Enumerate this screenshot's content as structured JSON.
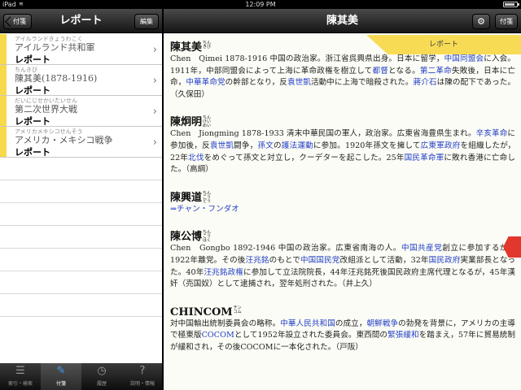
{
  "statusbar": {
    "carrier": "iPad",
    "wifi": "wifi-icon",
    "time": "12:09 PM",
    "battery_level": 0.85
  },
  "left_nav": {
    "back_label": "付箋",
    "title": "レポート",
    "edit_label": "編集"
  },
  "list": [
    {
      "ruby": "アイルランドきょうわこく",
      "name": "アイルランド共和軍",
      "tag": "レポート"
    },
    {
      "ruby": "ちんきび",
      "name": "陳其美(1878-1916)",
      "tag": "レポート"
    },
    {
      "ruby": "だいにじせかいたいせん",
      "name": "第二次世界大戦",
      "tag": "レポート"
    },
    {
      "ruby": "アメリカメキシコせんそう",
      "name": "アメリカ・メキシコ戦争",
      "tag": "レポート"
    }
  ],
  "tabs": [
    {
      "label": "索引・検索",
      "icon": "list-icon"
    },
    {
      "label": "付箋",
      "icon": "tag-icon"
    },
    {
      "label": "履歴",
      "icon": "clock-icon"
    },
    {
      "label": "説明・情報",
      "icon": "question-icon"
    }
  ],
  "right_nav": {
    "title": "陳其美",
    "gear_icon": "gear-icon",
    "fuse_label": "付箋"
  },
  "report_ribbon": "レポート",
  "entries": [
    {
      "headword": "陳其美",
      "yomi": "ちん きび",
      "segments": [
        {
          "t": "Chen　Qimei 1878-1916 中国の政治家。浙江省呉興県出身。日本に留学，"
        },
        {
          "t": "中国同盟会",
          "link": true
        },
        {
          "t": "に入会。1911年，中部同盟会によって上海に革命政権を樹立して"
        },
        {
          "t": "都督",
          "link": true
        },
        {
          "t": "となる。"
        },
        {
          "t": "第二革命",
          "link": true
        },
        {
          "t": "失敗後，日本に亡命，"
        },
        {
          "t": "中華革命党",
          "link": true
        },
        {
          "t": "の幹部となり，反"
        },
        {
          "t": "袁世凱",
          "link": true
        },
        {
          "t": "活動中に上海で暗殺された。"
        },
        {
          "t": "蔣介石",
          "link": true
        },
        {
          "t": "は陳の配下であった。（久保田）"
        }
      ]
    },
    {
      "headword": "陳炯明",
      "yomi": "ちん けいめい",
      "segments": [
        {
          "t": "Chen　Jiongming 1878-1933 清末中華民国の軍人，政治家。広東省海豊県生まれ。"
        },
        {
          "t": "辛亥革命",
          "link": true
        },
        {
          "t": "に参加後，反"
        },
        {
          "t": "袁世凱",
          "link": true
        },
        {
          "t": "闘争，"
        },
        {
          "t": "孫文",
          "link": true
        },
        {
          "t": "の"
        },
        {
          "t": "護法運動",
          "link": true
        },
        {
          "t": "に参加。1920年孫文を擁して"
        },
        {
          "t": "広東軍政府",
          "link": true
        },
        {
          "t": "を組織したが，22年"
        },
        {
          "t": "北伐",
          "link": true
        },
        {
          "t": "をめぐって孫文と対立し，クーデターを起こした。25年"
        },
        {
          "t": "国民革命軍",
          "link": true
        },
        {
          "t": "に敗れ香港に亡命した。（高綱）"
        }
      ]
    },
    {
      "headword": "陳興道",
      "yomi": "ちん こう どう",
      "segments": [
        {
          "t": "⇒チャン・フンダオ",
          "link": true
        }
      ]
    },
    {
      "headword": "陳公博",
      "yomi": "ちん こう はく",
      "segments": [
        {
          "t": "Chen　Gongbo 1892-1946 中国の政治家。広東省南海の人。"
        },
        {
          "t": "中国共産党",
          "link": true
        },
        {
          "t": "創立に参加するが，1922年離党。その後"
        },
        {
          "t": "汪兆銘",
          "link": true
        },
        {
          "t": "のもとで"
        },
        {
          "t": "中国国民党",
          "link": true
        },
        {
          "t": "改組派として活動，32年"
        },
        {
          "t": "国民政府",
          "link": true
        },
        {
          "t": "実業部長となった。40年"
        },
        {
          "t": "汪兆銘政権",
          "link": true
        },
        {
          "t": "に参加して立法院院長，44年汪兆銘死後国民政府主席代理となるが，45年漢奸（売国奴）として逮捕され，翌年処刑された。（井上久）"
        }
      ]
    },
    {
      "headword": "CHINCOM",
      "yomi": "チン コム",
      "segments": [
        {
          "t": "対中国輸出統制委員会の略称。"
        },
        {
          "t": "中華人民共和国",
          "link": true
        },
        {
          "t": "の成立，"
        },
        {
          "t": "朝鮮戦争",
          "link": true
        },
        {
          "t": "の勃発を背景に，アメリカの主導で極東版"
        },
        {
          "t": "COCOM",
          "link": true
        },
        {
          "t": "として1952年設立された委員会。東西間の"
        },
        {
          "t": "緊張緩和",
          "link": true
        },
        {
          "t": "を踏まえ，57年に貿易統制が緩和され，その後COCOMに一本化された。（戸阪）"
        }
      ]
    }
  ]
}
